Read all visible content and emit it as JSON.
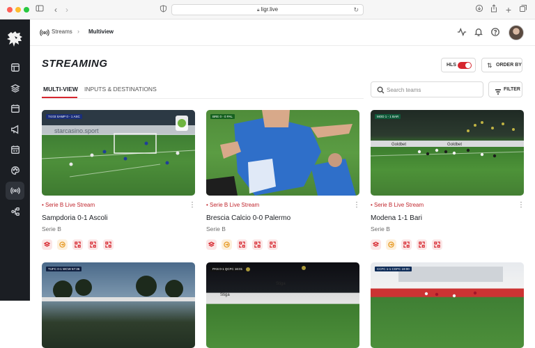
{
  "browser": {
    "url": "ligr.live"
  },
  "breadcrumb": {
    "section": "Streams",
    "current": "Multiview"
  },
  "page": {
    "title": "STREAMING"
  },
  "controls": {
    "hls_label": "HLS",
    "hls_enabled": true,
    "order_label": "ORDER BY",
    "filter_label": "FILTER",
    "search_placeholder": "Search teams"
  },
  "tabs": [
    {
      "label": "MULTI-VIEW",
      "active": true
    },
    {
      "label": "INPUTS & DESTINATIONS",
      "active": false
    }
  ],
  "colors": {
    "accent": "#d6262e",
    "sidebar": "#1b1e23"
  },
  "streams": [
    {
      "tag": "• Serie B Live Stream",
      "title": "Sampdoria 0-1 Ascoli",
      "league": "Serie B",
      "scorebug": "74:03  SAMP 0 - 1 ASC"
    },
    {
      "tag": "• Serie B Live Stream",
      "title": "Brescia Calcio 0-0 Palermo",
      "league": "Serie B",
      "scorebug": "BRE 0 - 0 PAL"
    },
    {
      "tag": "• Serie B Live Stream",
      "title": "Modena 1-1 Bari",
      "league": "Serie B",
      "scorebug": "MOD 1 - 1 BAR"
    },
    {
      "scorebug": "TUFC 0-1 WCW  67:36"
    },
    {
      "scorebug": "PAN 0-1 QCFC  16:01"
    },
    {
      "scorebug": "CCFC 1-1 CGFC  19:00"
    }
  ]
}
